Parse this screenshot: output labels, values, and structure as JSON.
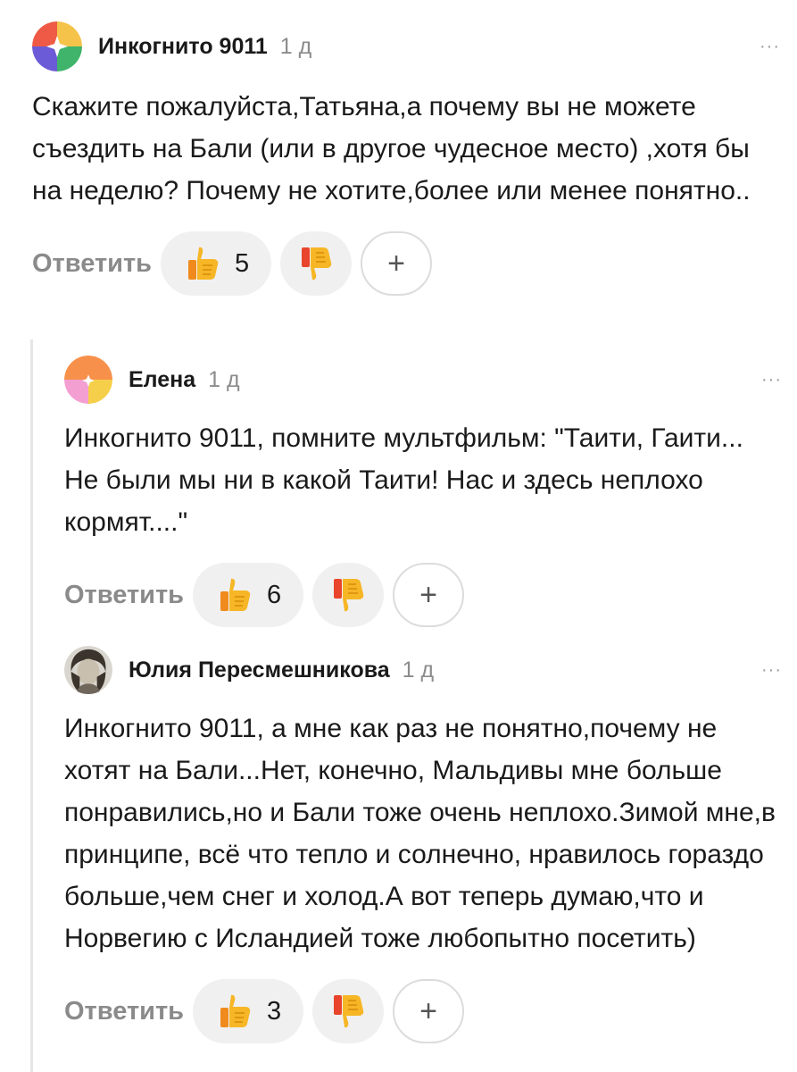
{
  "actions": {
    "reply_label": "Ответить",
    "plus_label": "+"
  },
  "icons": {
    "more": "more-dots-icon",
    "like": "thumbs-up-icon",
    "dislike": "thumbs-down-icon"
  },
  "colors": {
    "reply": "#8a8a8a",
    "date": "#8c8c8c",
    "pill_bg": "#f0f0f0"
  },
  "comments": [
    {
      "author": "Инкогнито 9011",
      "date": "1 д",
      "more": "···",
      "text": "Скажите пожалуйста,Татьяна,а почему вы не можете съездить на Бали (или в другое чудесное место) ,хотя бы на неделю? Почему не хотите,более или менее понятно..",
      "likes": "5"
    },
    {
      "author": "Елена",
      "date": "1 д",
      "more": "···",
      "text": "Инкогнито 9011,  помните мультфильм: \"Таити, Гаити... Не были мы ни в какой Таити! Нас и здесь неплохо кормят....\"",
      "likes": "6"
    },
    {
      "author": "Юлия Пересмешникова",
      "date": "1 д",
      "more": "···",
      "text": "Инкогнито 9011, а мне как раз не понятно,почему не хотят на Бали...Нет, конечно, Мальдивы мне больше понравились,но и Бали тоже очень неплохо.Зимой мне,в принципе, всё что тепло и солнечно, нравилось гораздо больше,чем снег и холод.А вот теперь думаю,что и Норвегию с Исландией тоже любопытно посетить)",
      "likes": "3"
    }
  ]
}
